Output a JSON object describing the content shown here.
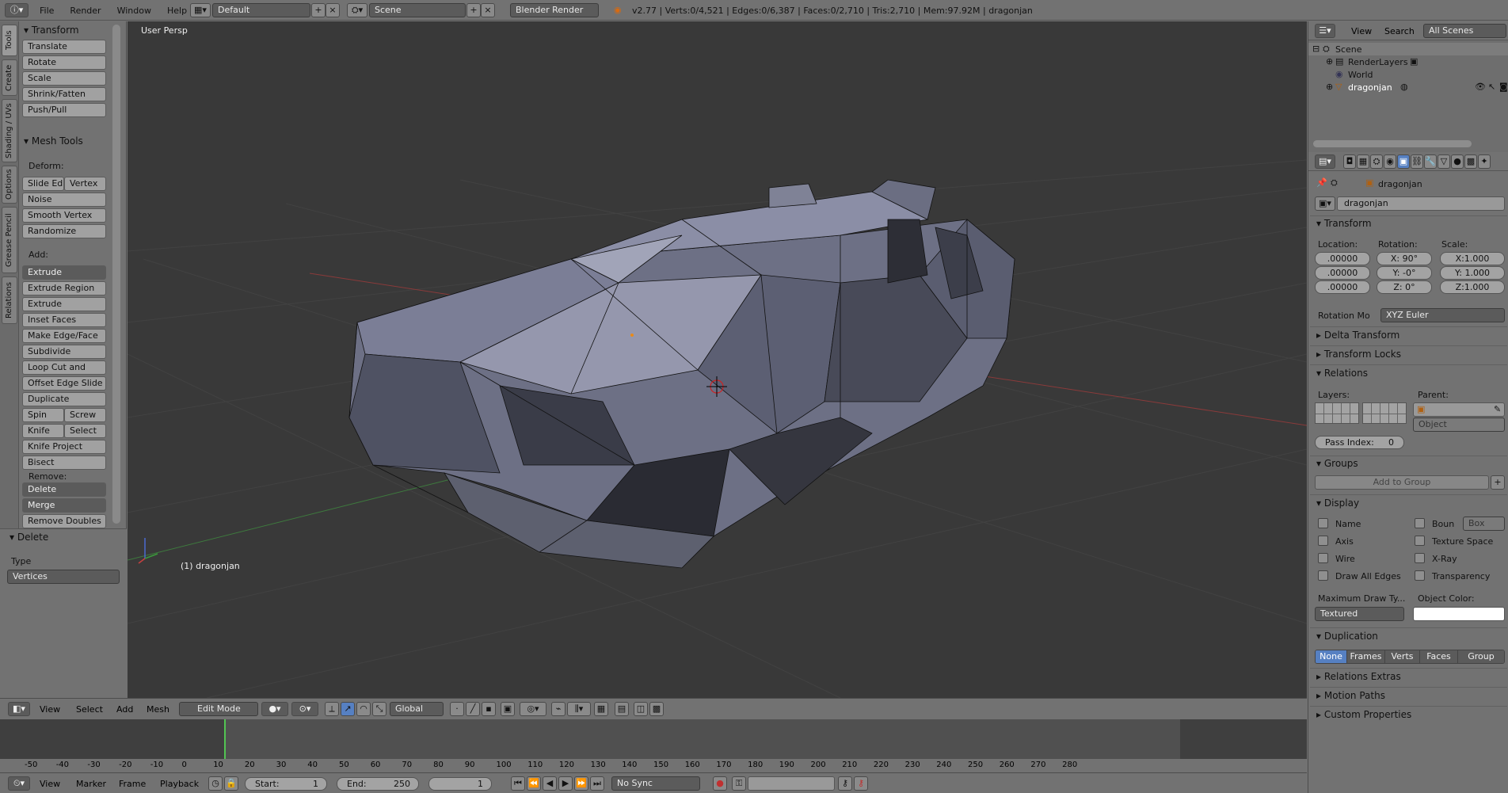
{
  "topbar": {
    "menus": [
      "File",
      "Render",
      "Window",
      "Help"
    ],
    "layout": "Default",
    "scene": "Scene",
    "engine": "Blender Render",
    "stats": "v2.77 | Verts:0/4,521 | Edges:0/6,387 | Faces:0/2,710 | Tris:2,710 | Mem:97.92M | dragonjan"
  },
  "tabs": [
    "Tools",
    "Create",
    "Shading / UVs",
    "Options",
    "Grease Pencil",
    "Relations"
  ],
  "tools": {
    "transform_title": "Transform",
    "transform": [
      "Translate",
      "Rotate",
      "Scale",
      "Shrink/Fatten",
      "Push/Pull"
    ],
    "mesh_title": "Mesh Tools",
    "deform_label": "Deform:",
    "slide_edge": "Slide Ed",
    "vertex": "Vertex",
    "noise": "Noise",
    "smooth": "Smooth Vertex",
    "randomize": "Randomize",
    "add_label": "Add:",
    "extrude": "Extrude",
    "add_items": [
      "Extrude Region",
      "Extrude Individual",
      "Inset Faces",
      "Make Edge/Face",
      "Subdivide",
      "Loop Cut and Slide",
      "Offset Edge Slide",
      "Duplicate"
    ],
    "spin": "Spin",
    "screw": "Screw",
    "knife": "Knife",
    "select": "Select",
    "knife_project": "Knife Project",
    "bisect": "Bisect",
    "remove_label": "Remove:",
    "delete": "Delete",
    "merge": "Merge",
    "remove_doubles": "Remove Doubles",
    "op_title": "Delete",
    "type_label": "Type",
    "type_value": "Vertices"
  },
  "viewport": {
    "view_label": "User Persp",
    "object_label": "(1) dragonjan"
  },
  "vheader": {
    "menus": [
      "View",
      "Select",
      "Add",
      "Mesh"
    ],
    "mode": "Edit Mode",
    "orientation": "Global"
  },
  "timeline": {
    "ticks": [
      "-50",
      "-40",
      "-30",
      "-20",
      "-10",
      "0",
      "10",
      "20",
      "30",
      "40",
      "50",
      "60",
      "70",
      "80",
      "90",
      "100",
      "110",
      "120",
      "130",
      "140",
      "150",
      "160",
      "170",
      "180",
      "190",
      "200",
      "210",
      "220",
      "230",
      "240",
      "250",
      "260",
      "270",
      "280"
    ]
  },
  "tlheader": {
    "menus": [
      "View",
      "Marker",
      "Frame",
      "Playback"
    ],
    "start": "Start:",
    "start_val": "1",
    "end": "End:",
    "end_val": "250",
    "current": "1",
    "sync": "No Sync"
  },
  "outliner": {
    "menus": [
      "View",
      "Search"
    ],
    "filter": "All Scenes",
    "items": [
      "Scene",
      "RenderLayers",
      "World",
      "dragonjan"
    ]
  },
  "props": {
    "crumb": "dragonjan",
    "name": "dragonjan",
    "transform_title": "Transform",
    "location": "Location:",
    "rotation": "Rotation:",
    "scale": "Scale:",
    "loc": [
      ".00000",
      ".00000",
      ".00000"
    ],
    "rot": [
      "X:",
      "90°",
      "Y:",
      "-0°",
      "Z:",
      "0°"
    ],
    "scl": [
      "X:1.000",
      "Y: 1.000",
      "Z:1.000"
    ],
    "rotmode_label": "Rotation Mo",
    "rotmode": "XYZ Euler",
    "delta": "Delta Transform",
    "locks": "Transform Locks",
    "relations": "Relations",
    "layers": "Layers:",
    "parent": "Parent:",
    "parent_type": "Object",
    "pass_index": "Pass Index:",
    "pass_val": "0",
    "groups": "Groups",
    "add_group": "Add to Group",
    "display": "Display",
    "disp_left": [
      "Name",
      "Axis",
      "Wire",
      "Draw All Edges"
    ],
    "disp_right": [
      "Boun",
      "Texture Space",
      "X-Ray",
      "Transparency"
    ],
    "bounds_type": "Box",
    "maxdraw": "Maximum Draw Ty...",
    "objcolor": "Object Color:",
    "maxdraw_val": "Textured",
    "duplication": "Duplication",
    "dup": [
      "None",
      "Frames",
      "Verts",
      "Faces",
      "Group"
    ],
    "extras": "Relations Extras",
    "motion": "Motion Paths",
    "custom": "Custom Properties"
  }
}
